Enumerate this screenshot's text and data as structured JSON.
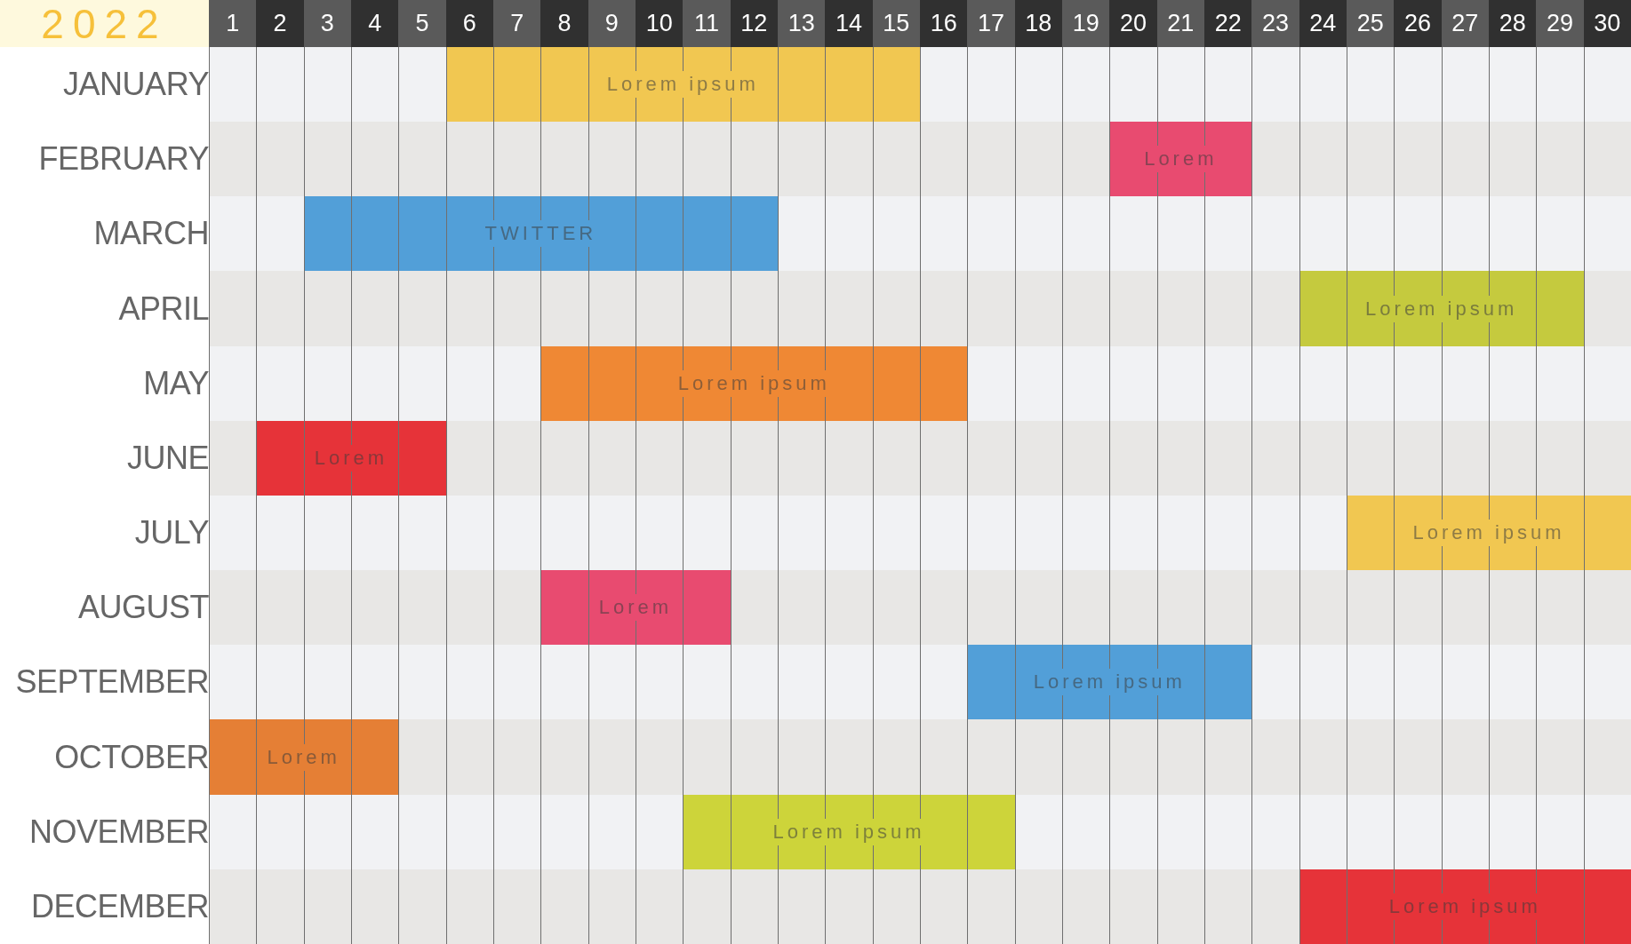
{
  "year": "2022",
  "days": [
    "1",
    "2",
    "3",
    "4",
    "5",
    "6",
    "7",
    "8",
    "9",
    "10",
    "11",
    "12",
    "13",
    "14",
    "15",
    "16",
    "17",
    "18",
    "19",
    "20",
    "21",
    "22",
    "23",
    "24",
    "25",
    "26",
    "27",
    "28",
    "29",
    "30"
  ],
  "months": [
    {
      "name": "JANUARY",
      "event": {
        "label": "Lorem ipsum",
        "color": "#f1c751"
      },
      "cells": [
        {
          "filled": false
        },
        {
          "filled": false
        },
        {
          "filled": false
        },
        {
          "filled": false
        },
        {
          "filled": false
        },
        {
          "filled": true
        },
        {
          "filled": true
        },
        {
          "filled": true
        },
        {
          "filled": true
        },
        {
          "filled": true
        },
        {
          "filled": true
        },
        {
          "filled": true
        },
        {
          "filled": true
        },
        {
          "filled": true
        },
        {
          "filled": true
        },
        {
          "filled": false
        },
        {
          "filled": false
        },
        {
          "filled": false
        },
        {
          "filled": false
        },
        {
          "filled": false
        },
        {
          "filled": false
        },
        {
          "filled": false
        },
        {
          "filled": false
        },
        {
          "filled": false
        },
        {
          "filled": false
        },
        {
          "filled": false
        },
        {
          "filled": false
        },
        {
          "filled": false
        },
        {
          "filled": false
        },
        {
          "filled": false
        }
      ]
    },
    {
      "name": "FEBRUARY",
      "event": {
        "label": "Lorem",
        "color": "#e84b70"
      },
      "cells": [
        {
          "filled": false
        },
        {
          "filled": false
        },
        {
          "filled": false
        },
        {
          "filled": false
        },
        {
          "filled": false
        },
        {
          "filled": false
        },
        {
          "filled": false
        },
        {
          "filled": false
        },
        {
          "filled": false
        },
        {
          "filled": false
        },
        {
          "filled": false
        },
        {
          "filled": false
        },
        {
          "filled": false
        },
        {
          "filled": false
        },
        {
          "filled": false
        },
        {
          "filled": false
        },
        {
          "filled": false
        },
        {
          "filled": false
        },
        {
          "filled": false
        },
        {
          "filled": true
        },
        {
          "filled": true
        },
        {
          "filled": true
        },
        {
          "filled": false
        },
        {
          "filled": false
        },
        {
          "filled": false
        },
        {
          "filled": false
        },
        {
          "filled": false
        },
        {
          "filled": false
        },
        {
          "filled": false
        },
        {
          "filled": false
        }
      ]
    },
    {
      "name": "MARCH",
      "event": {
        "label": "TWITTER",
        "color": "#529fd8"
      },
      "cells": [
        {
          "filled": false
        },
        {
          "filled": false
        },
        {
          "filled": true
        },
        {
          "filled": true
        },
        {
          "filled": true
        },
        {
          "filled": true
        },
        {
          "filled": true
        },
        {
          "filled": true
        },
        {
          "filled": true
        },
        {
          "filled": true
        },
        {
          "filled": true
        },
        {
          "filled": true
        },
        {
          "filled": false
        },
        {
          "filled": false
        },
        {
          "filled": false
        },
        {
          "filled": false
        },
        {
          "filled": false
        },
        {
          "filled": false
        },
        {
          "filled": false
        },
        {
          "filled": false
        },
        {
          "filled": false
        },
        {
          "filled": false
        },
        {
          "filled": false
        },
        {
          "filled": false
        },
        {
          "filled": false
        },
        {
          "filled": false
        },
        {
          "filled": false
        },
        {
          "filled": false
        },
        {
          "filled": false
        },
        {
          "filled": false
        }
      ]
    },
    {
      "name": "APRIL",
      "event": {
        "label": "Lorem ipsum",
        "color": "#c5ca3e"
      },
      "cells": [
        {
          "filled": false
        },
        {
          "filled": false
        },
        {
          "filled": false
        },
        {
          "filled": false
        },
        {
          "filled": false
        },
        {
          "filled": false
        },
        {
          "filled": false
        },
        {
          "filled": false
        },
        {
          "filled": false
        },
        {
          "filled": false
        },
        {
          "filled": false
        },
        {
          "filled": false
        },
        {
          "filled": false
        },
        {
          "filled": false
        },
        {
          "filled": false
        },
        {
          "filled": false
        },
        {
          "filled": false
        },
        {
          "filled": false
        },
        {
          "filled": false
        },
        {
          "filled": false
        },
        {
          "filled": false
        },
        {
          "filled": false
        },
        {
          "filled": false
        },
        {
          "filled": true
        },
        {
          "filled": true
        },
        {
          "filled": true
        },
        {
          "filled": true
        },
        {
          "filled": true
        },
        {
          "filled": true
        },
        {
          "filled": false
        }
      ]
    },
    {
      "name": "MAY",
      "event": {
        "label": "Lorem ipsum",
        "color": "#ef8834"
      },
      "cells": [
        {
          "filled": false
        },
        {
          "filled": false
        },
        {
          "filled": false
        },
        {
          "filled": false
        },
        {
          "filled": false
        },
        {
          "filled": false
        },
        {
          "filled": false
        },
        {
          "filled": true
        },
        {
          "filled": true
        },
        {
          "filled": true
        },
        {
          "filled": true
        },
        {
          "filled": true
        },
        {
          "filled": true
        },
        {
          "filled": true
        },
        {
          "filled": true
        },
        {
          "filled": true
        },
        {
          "filled": false
        },
        {
          "filled": false
        },
        {
          "filled": false
        },
        {
          "filled": false
        },
        {
          "filled": false
        },
        {
          "filled": false
        },
        {
          "filled": false
        },
        {
          "filled": false
        },
        {
          "filled": false
        },
        {
          "filled": false
        },
        {
          "filled": false
        },
        {
          "filled": false
        },
        {
          "filled": false
        },
        {
          "filled": false
        }
      ]
    },
    {
      "name": "JUNE",
      "event": {
        "label": "Lorem",
        "color": "#e63339"
      },
      "cells": [
        {
          "filled": false
        },
        {
          "filled": true
        },
        {
          "filled": true
        },
        {
          "filled": true
        },
        {
          "filled": true
        },
        {
          "filled": false
        },
        {
          "filled": false
        },
        {
          "filled": false
        },
        {
          "filled": false
        },
        {
          "filled": false
        },
        {
          "filled": false
        },
        {
          "filled": false
        },
        {
          "filled": false
        },
        {
          "filled": false
        },
        {
          "filled": false
        },
        {
          "filled": false
        },
        {
          "filled": false
        },
        {
          "filled": false
        },
        {
          "filled": false
        },
        {
          "filled": false
        },
        {
          "filled": false
        },
        {
          "filled": false
        },
        {
          "filled": false
        },
        {
          "filled": false
        },
        {
          "filled": false
        },
        {
          "filled": false
        },
        {
          "filled": false
        },
        {
          "filled": false
        },
        {
          "filled": false
        },
        {
          "filled": false
        }
      ]
    },
    {
      "name": "JULY",
      "event": {
        "label": "Lorem ipsum",
        "color": "#f1c751"
      },
      "cells": [
        {
          "filled": false
        },
        {
          "filled": false
        },
        {
          "filled": false
        },
        {
          "filled": false
        },
        {
          "filled": false
        },
        {
          "filled": false
        },
        {
          "filled": false
        },
        {
          "filled": false
        },
        {
          "filled": false
        },
        {
          "filled": false
        },
        {
          "filled": false
        },
        {
          "filled": false
        },
        {
          "filled": false
        },
        {
          "filled": false
        },
        {
          "filled": false
        },
        {
          "filled": false
        },
        {
          "filled": false
        },
        {
          "filled": false
        },
        {
          "filled": false
        },
        {
          "filled": false
        },
        {
          "filled": false
        },
        {
          "filled": false
        },
        {
          "filled": false
        },
        {
          "filled": false
        },
        {
          "filled": true
        },
        {
          "filled": true
        },
        {
          "filled": true
        },
        {
          "filled": true
        },
        {
          "filled": true
        },
        {
          "filled": true
        }
      ]
    },
    {
      "name": "AUGUST",
      "event": {
        "label": "Lorem",
        "color": "#e84b70"
      },
      "cells": [
        {
          "filled": false
        },
        {
          "filled": false
        },
        {
          "filled": false
        },
        {
          "filled": false
        },
        {
          "filled": false
        },
        {
          "filled": false
        },
        {
          "filled": false
        },
        {
          "filled": true
        },
        {
          "filled": true
        },
        {
          "filled": true
        },
        {
          "filled": true
        },
        {
          "filled": false
        },
        {
          "filled": false
        },
        {
          "filled": false
        },
        {
          "filled": false
        },
        {
          "filled": false
        },
        {
          "filled": false
        },
        {
          "filled": false
        },
        {
          "filled": false
        },
        {
          "filled": false
        },
        {
          "filled": false
        },
        {
          "filled": false
        },
        {
          "filled": false
        },
        {
          "filled": false
        },
        {
          "filled": false
        },
        {
          "filled": false
        },
        {
          "filled": false
        },
        {
          "filled": false
        },
        {
          "filled": false
        },
        {
          "filled": false
        }
      ]
    },
    {
      "name": "SEPTEMBER",
      "event": {
        "label": "Lorem ipsum",
        "color": "#529fd8"
      },
      "cells": [
        {
          "filled": false
        },
        {
          "filled": false
        },
        {
          "filled": false
        },
        {
          "filled": false
        },
        {
          "filled": false
        },
        {
          "filled": false
        },
        {
          "filled": false
        },
        {
          "filled": false
        },
        {
          "filled": false
        },
        {
          "filled": false
        },
        {
          "filled": false
        },
        {
          "filled": false
        },
        {
          "filled": false
        },
        {
          "filled": false
        },
        {
          "filled": false
        },
        {
          "filled": false
        },
        {
          "filled": true
        },
        {
          "filled": true
        },
        {
          "filled": true
        },
        {
          "filled": true
        },
        {
          "filled": true
        },
        {
          "filled": true
        },
        {
          "filled": false
        },
        {
          "filled": false
        },
        {
          "filled": false
        },
        {
          "filled": false
        },
        {
          "filled": false
        },
        {
          "filled": false
        },
        {
          "filled": false
        },
        {
          "filled": false
        }
      ]
    },
    {
      "name": "OCTOBER",
      "event": {
        "label": "Lorem",
        "color": "#e57f35"
      },
      "cells": [
        {
          "filled": true
        },
        {
          "filled": true
        },
        {
          "filled": true
        },
        {
          "filled": true
        },
        {
          "filled": false
        },
        {
          "filled": false
        },
        {
          "filled": false
        },
        {
          "filled": false
        },
        {
          "filled": false
        },
        {
          "filled": false
        },
        {
          "filled": false
        },
        {
          "filled": false
        },
        {
          "filled": false
        },
        {
          "filled": false
        },
        {
          "filled": false
        },
        {
          "filled": false
        },
        {
          "filled": false
        },
        {
          "filled": false
        },
        {
          "filled": false
        },
        {
          "filled": false
        },
        {
          "filled": false
        },
        {
          "filled": false
        },
        {
          "filled": false
        },
        {
          "filled": false
        },
        {
          "filled": false
        },
        {
          "filled": false
        },
        {
          "filled": false
        },
        {
          "filled": false
        },
        {
          "filled": false
        },
        {
          "filled": false
        }
      ]
    },
    {
      "name": "NOVEMBER",
      "event": {
        "label": "Lorem ipsum",
        "color": "#cdd43a"
      },
      "cells": [
        {
          "filled": false
        },
        {
          "filled": false
        },
        {
          "filled": false
        },
        {
          "filled": false
        },
        {
          "filled": false
        },
        {
          "filled": false
        },
        {
          "filled": false
        },
        {
          "filled": false
        },
        {
          "filled": false
        },
        {
          "filled": false
        },
        {
          "filled": true
        },
        {
          "filled": true
        },
        {
          "filled": true
        },
        {
          "filled": true
        },
        {
          "filled": true
        },
        {
          "filled": true
        },
        {
          "filled": true
        },
        {
          "filled": false
        },
        {
          "filled": false
        },
        {
          "filled": false
        },
        {
          "filled": false
        },
        {
          "filled": false
        },
        {
          "filled": false
        },
        {
          "filled": false
        },
        {
          "filled": false
        },
        {
          "filled": false
        },
        {
          "filled": false
        },
        {
          "filled": false
        },
        {
          "filled": false
        },
        {
          "filled": false
        }
      ]
    },
    {
      "name": "DECEMBER",
      "event": {
        "label": "Lorem ipsum",
        "color": "#e63339"
      },
      "cells": [
        {
          "filled": false
        },
        {
          "filled": false
        },
        {
          "filled": false
        },
        {
          "filled": false
        },
        {
          "filled": false
        },
        {
          "filled": false
        },
        {
          "filled": false
        },
        {
          "filled": false
        },
        {
          "filled": false
        },
        {
          "filled": false
        },
        {
          "filled": false
        },
        {
          "filled": false
        },
        {
          "filled": false
        },
        {
          "filled": false
        },
        {
          "filled": false
        },
        {
          "filled": false
        },
        {
          "filled": false
        },
        {
          "filled": false
        },
        {
          "filled": false
        },
        {
          "filled": false
        },
        {
          "filled": false
        },
        {
          "filled": false
        },
        {
          "filled": false
        },
        {
          "filled": true
        },
        {
          "filled": true
        },
        {
          "filled": true
        },
        {
          "filled": true
        },
        {
          "filled": true
        },
        {
          "filled": true
        },
        {
          "filled": true
        }
      ]
    }
  ]
}
